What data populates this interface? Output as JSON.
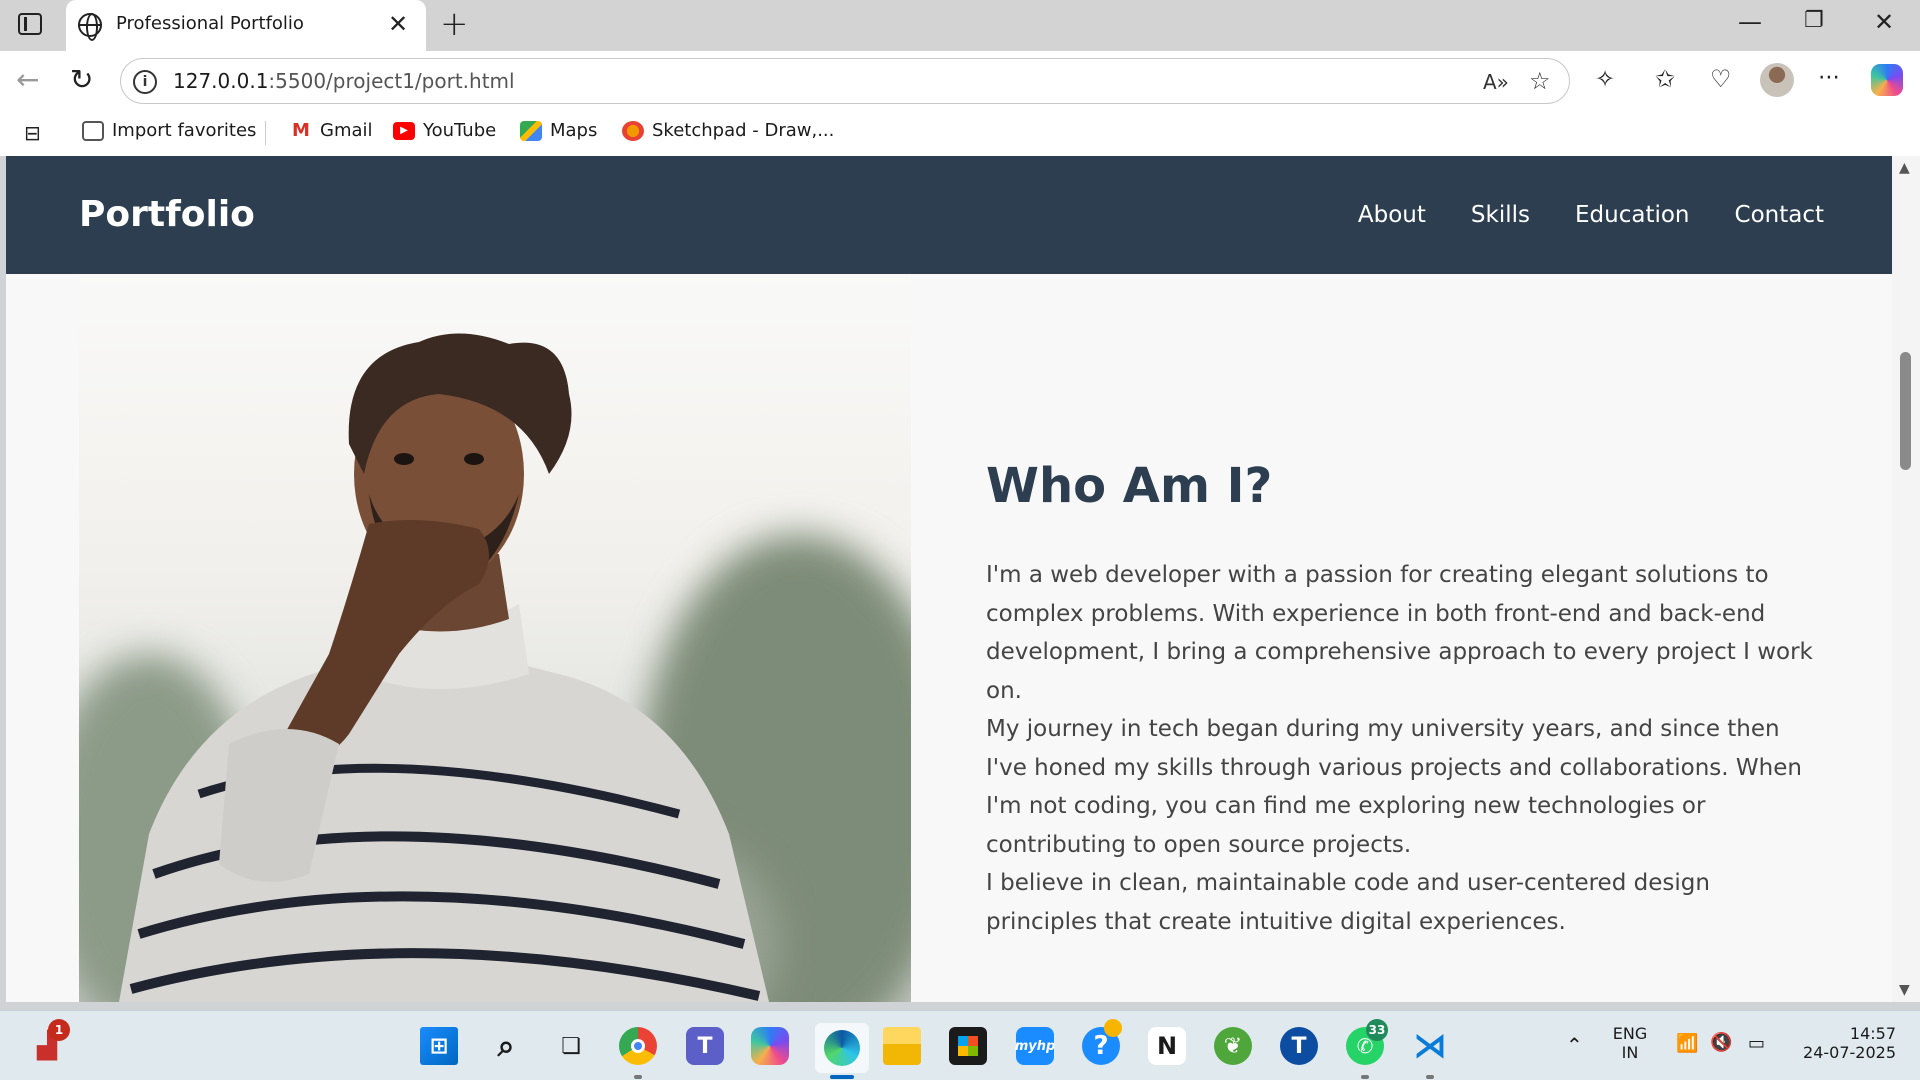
{
  "browser": {
    "tab_title": "Professional Portfolio",
    "url_host": "127.0.0.1",
    "url_path": ":5500/project1/port.html",
    "bookmarks": [
      {
        "label": "Import favorites",
        "icon": "import-icon",
        "color": "#555555"
      },
      {
        "label": "Gmail",
        "icon": "gmail-icon",
        "color": "#d93025"
      },
      {
        "label": "YouTube",
        "icon": "youtube-icon",
        "color": "#ff0000"
      },
      {
        "label": "Maps",
        "icon": "maps-icon",
        "color": "#34a853"
      },
      {
        "label": "Sketchpad - Draw,...",
        "icon": "sketchpad-icon",
        "color": "#f29900"
      }
    ]
  },
  "site": {
    "brand": "Portfolio",
    "nav": [
      "About",
      "Skills",
      "Education",
      "Contact"
    ],
    "header_color": "#2c3e50",
    "about": {
      "title": "Who Am I?",
      "paragraphs": [
        "I'm a web developer with a passion for creating elegant solutions to complex problems. With experience in both front-end and back-end development, I bring a comprehensive approach to every project I work on.",
        "My journey in tech began during my university years, and since then I've honed my skills through various projects and collaborations. When I'm not coding, you can find me exploring new technologies or contributing to open source projects.",
        "I believe in clean, maintainable code and user-centered design principles that create intuitive digital experiences."
      ]
    }
  },
  "taskbar": {
    "apps": [
      {
        "name": "start",
        "icon": "windows-icon"
      },
      {
        "name": "search",
        "icon": "search-icon"
      },
      {
        "name": "task-view",
        "icon": "task-view-icon"
      },
      {
        "name": "chrome",
        "icon": "chrome-icon"
      },
      {
        "name": "teams",
        "icon": "teams-icon"
      },
      {
        "name": "copilot",
        "icon": "copilot-icon"
      },
      {
        "name": "edge",
        "icon": "edge-icon"
      },
      {
        "name": "file-explorer",
        "icon": "folder-icon"
      },
      {
        "name": "store",
        "icon": "store-icon"
      },
      {
        "name": "myhp",
        "icon": "myhp-icon",
        "label": "myhp"
      },
      {
        "name": "help",
        "icon": "help-icon"
      },
      {
        "name": "notion",
        "icon": "notion-icon"
      },
      {
        "name": "spring",
        "icon": "spring-icon"
      },
      {
        "name": "t-app",
        "icon": "t-app-icon",
        "label": "T"
      },
      {
        "name": "whatsapp",
        "icon": "whatsapp-icon",
        "badge": "33"
      },
      {
        "name": "vscode",
        "icon": "vscode-icon"
      }
    ],
    "widget_badge": "1",
    "language": "ENG",
    "region": "IN",
    "time": "14:57",
    "date": "24-07-2025"
  }
}
